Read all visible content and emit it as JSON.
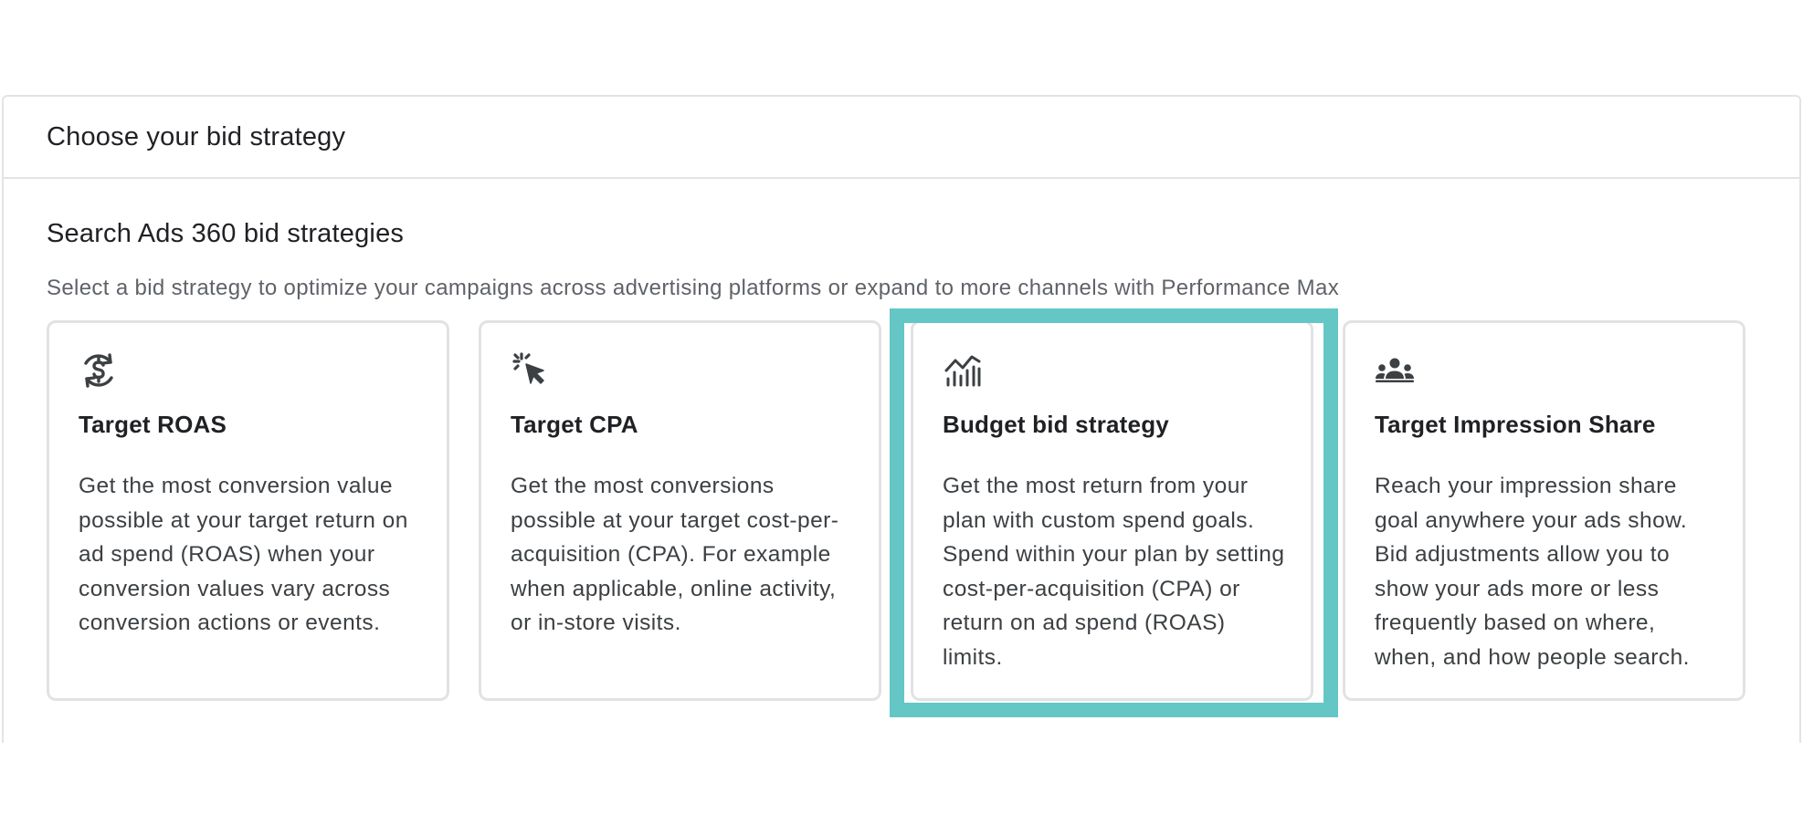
{
  "panel": {
    "title": "Choose your bid strategy"
  },
  "section": {
    "title": "Search Ads 360 bid strategies",
    "description": "Select a bid strategy to optimize your campaigns across advertising platforms or expand to more channels with Performance Max"
  },
  "cards": [
    {
      "icon": "dollar-sync-icon",
      "title": "Target ROAS",
      "description": "Get the most conversion value possible at your target return on ad spend (ROAS) when your conversion values vary across conversion actions or events."
    },
    {
      "icon": "cursor-click-icon",
      "title": "Target CPA",
      "description": "Get the most conversions possible at your target cost-per-acquisition (CPA). For example when applicable, online activity, or in-store visits."
    },
    {
      "icon": "chart-trend-icon",
      "title": "Budget bid strategy",
      "description": "Get the most return from your plan with custom spend goals. Spend within your plan by setting cost-per-acquisition (CPA) or return on ad spend (ROAS) limits.",
      "highlighted": true
    },
    {
      "icon": "people-group-icon",
      "title": "Target Impression Share",
      "description": "Reach your impression share goal anywhere your ads show. Bid adjustments allow you to show your ads more or less frequently based on where, when, and how people search."
    }
  ],
  "colors": {
    "highlight": "#65c6c6",
    "card_border": "#e2e2e4",
    "text_primary": "#202124",
    "text_secondary": "#5f6368"
  }
}
